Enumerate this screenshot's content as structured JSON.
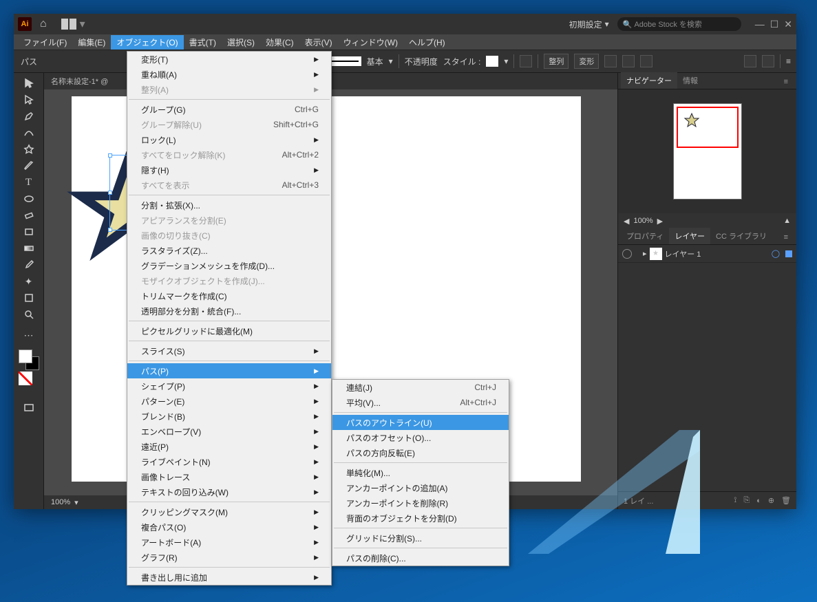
{
  "title": {
    "preset": "初期設定",
    "search_placeholder": "Adobe Stock を検索"
  },
  "menubar": [
    "ファイル(F)",
    "編集(E)",
    "オブジェクト(O)",
    "書式(T)",
    "選択(S)",
    "効果(C)",
    "表示(V)",
    "ウィンドウ(W)",
    "ヘルプ(H)"
  ],
  "optbar": {
    "label": "パス",
    "stroke_style": "基本",
    "opacity": "不透明度",
    "style": "スタイル :",
    "align": "整列",
    "transform": "変形"
  },
  "doc": {
    "tab": "名称未設定-1* @",
    "zoom": "100%"
  },
  "right": {
    "nav_tabs": [
      "ナビゲーター",
      "情報"
    ],
    "nav_zoom": "100%",
    "layer_tabs": [
      "プロパティ",
      "レイヤー",
      "CC ライブラリ"
    ],
    "layer_name": "レイヤー 1",
    "layer_count": "1 レイ ..."
  },
  "object_menu": [
    {
      "label": "変形(T)",
      "sub": true
    },
    {
      "label": "重ね順(A)",
      "sub": true
    },
    {
      "label": "整列(A)",
      "sub": true,
      "disabled": true
    },
    {
      "sep": true
    },
    {
      "label": "グループ(G)",
      "shortcut": "Ctrl+G"
    },
    {
      "label": "グループ解除(U)",
      "shortcut": "Shift+Ctrl+G",
      "disabled": true
    },
    {
      "label": "ロック(L)",
      "sub": true
    },
    {
      "label": "すべてをロック解除(K)",
      "shortcut": "Alt+Ctrl+2",
      "disabled": true
    },
    {
      "label": "隠す(H)",
      "sub": true
    },
    {
      "label": "すべてを表示",
      "shortcut": "Alt+Ctrl+3",
      "disabled": true
    },
    {
      "sep": true
    },
    {
      "label": "分割・拡張(X)..."
    },
    {
      "label": "アピアランスを分割(E)",
      "disabled": true
    },
    {
      "label": "画像の切り抜き(C)",
      "disabled": true
    },
    {
      "label": "ラスタライズ(Z)..."
    },
    {
      "label": "グラデーションメッシュを作成(D)..."
    },
    {
      "label": "モザイクオブジェクトを作成(J)...",
      "disabled": true
    },
    {
      "label": "トリムマークを作成(C)"
    },
    {
      "label": "透明部分を分割・統合(F)..."
    },
    {
      "sep": true
    },
    {
      "label": "ピクセルグリッドに最適化(M)"
    },
    {
      "sep": true
    },
    {
      "label": "スライス(S)",
      "sub": true
    },
    {
      "sep": true
    },
    {
      "label": "パス(P)",
      "sub": true,
      "highlight": true
    },
    {
      "label": "シェイプ(P)",
      "sub": true
    },
    {
      "label": "パターン(E)",
      "sub": true
    },
    {
      "label": "ブレンド(B)",
      "sub": true
    },
    {
      "label": "エンベロープ(V)",
      "sub": true
    },
    {
      "label": "遠近(P)",
      "sub": true
    },
    {
      "label": "ライブペイント(N)",
      "sub": true
    },
    {
      "label": "画像トレース",
      "sub": true
    },
    {
      "label": "テキストの回り込み(W)",
      "sub": true
    },
    {
      "sep": true
    },
    {
      "label": "クリッピングマスク(M)",
      "sub": true
    },
    {
      "label": "複合パス(O)",
      "sub": true
    },
    {
      "label": "アートボード(A)",
      "sub": true
    },
    {
      "label": "グラフ(R)",
      "sub": true
    },
    {
      "sep": true
    },
    {
      "label": "書き出し用に追加",
      "sub": true
    }
  ],
  "path_submenu": [
    {
      "label": "連結(J)",
      "shortcut": "Ctrl+J"
    },
    {
      "label": "平均(V)...",
      "shortcut": "Alt+Ctrl+J"
    },
    {
      "sep": true
    },
    {
      "label": "パスのアウトライン(U)",
      "highlight": true
    },
    {
      "label": "パスのオフセット(O)..."
    },
    {
      "label": "パスの方向反転(E)"
    },
    {
      "sep": true
    },
    {
      "label": "単純化(M)..."
    },
    {
      "label": "アンカーポイントの追加(A)"
    },
    {
      "label": "アンカーポイントを削除(R)"
    },
    {
      "label": "背面のオブジェクトを分割(D)"
    },
    {
      "sep": true
    },
    {
      "label": "グリッドに分割(S)..."
    },
    {
      "sep": true
    },
    {
      "label": "パスの削除(C)..."
    }
  ]
}
